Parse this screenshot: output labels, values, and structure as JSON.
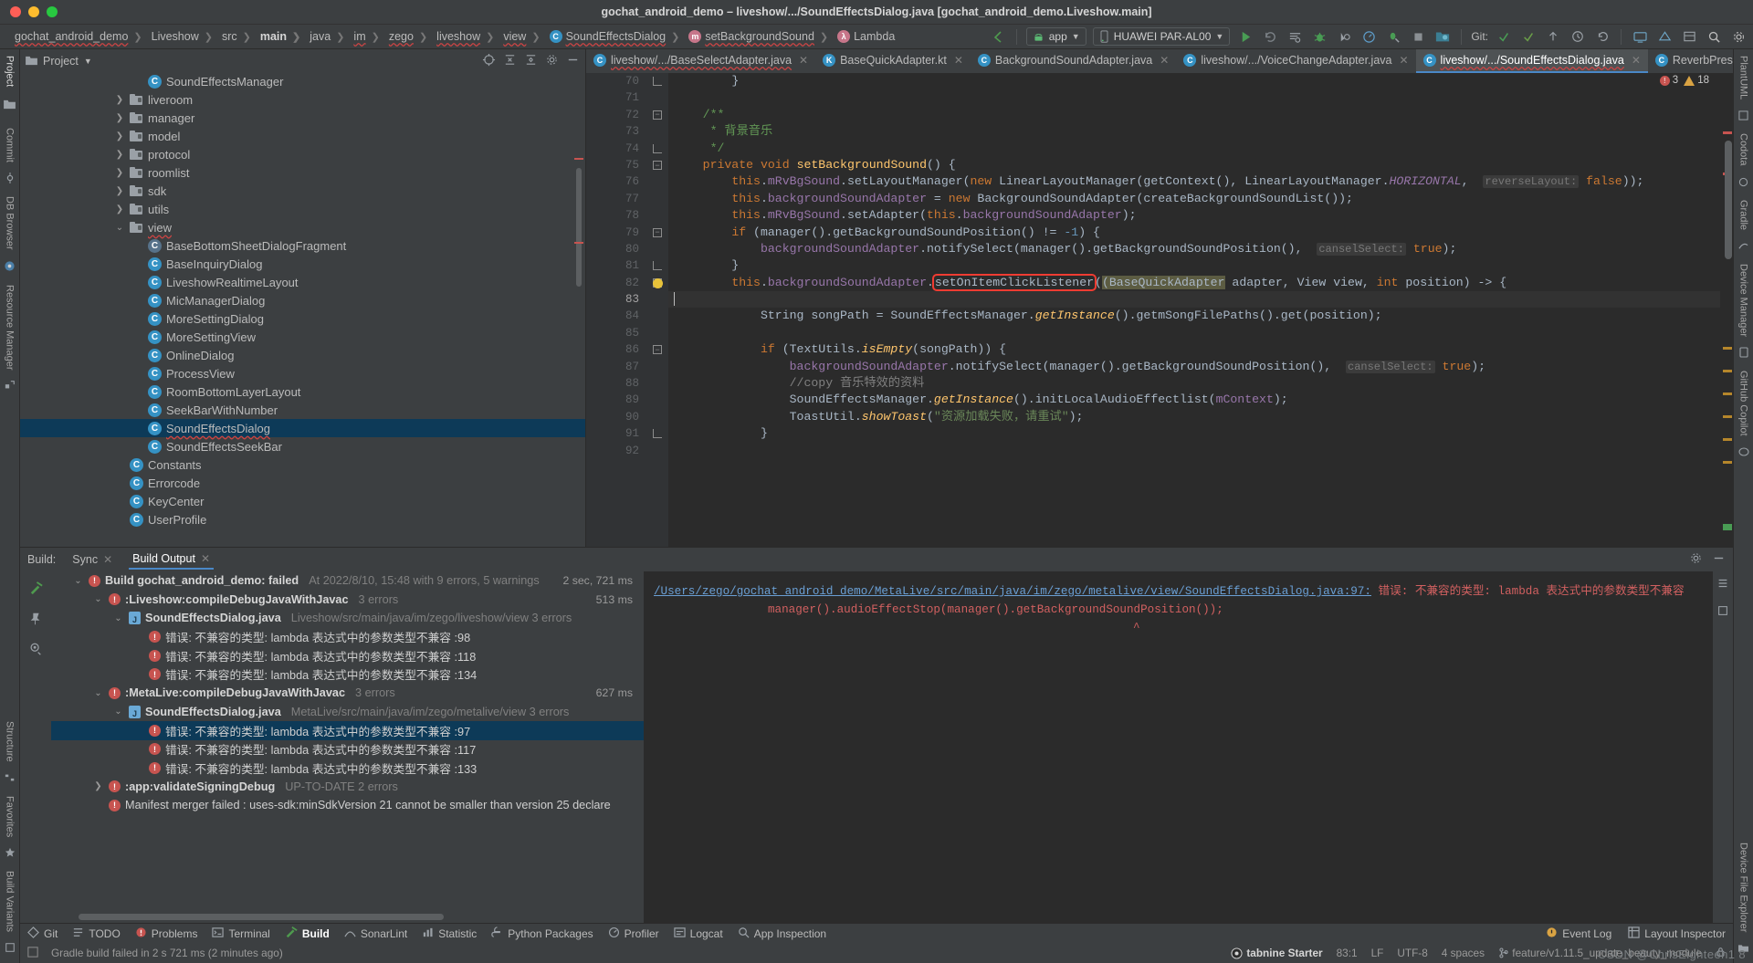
{
  "window": {
    "title": "gochat_android_demo – liveshow/.../SoundEffectsDialog.java [gochat_android_demo.Liveshow.main]"
  },
  "breadcrumb": [
    {
      "label": "gochat_android_demo",
      "bold": false,
      "icon": ""
    },
    {
      "label": "Liveshow",
      "bold": false,
      "icon": ""
    },
    {
      "label": "src",
      "bold": false,
      "icon": ""
    },
    {
      "label": "main",
      "bold": true,
      "icon": ""
    },
    {
      "label": "java",
      "bold": false,
      "icon": ""
    },
    {
      "label": "im",
      "bold": false,
      "icon": ""
    },
    {
      "label": "zego",
      "bold": false,
      "icon": ""
    },
    {
      "label": "liveshow",
      "bold": false,
      "icon": ""
    },
    {
      "label": "view",
      "bold": false,
      "icon": ""
    },
    {
      "label": "SoundEffectsDialog",
      "bold": false,
      "icon": "class-icon"
    },
    {
      "label": "setBackgroundSound",
      "bold": false,
      "icon": "method-icon"
    },
    {
      "label": "Lambda",
      "bold": false,
      "icon": "lambda-icon"
    }
  ],
  "toolbar": {
    "module_selector": "app",
    "device_selector": "HUAWEI PAR-AL00",
    "git_label": "Git:",
    "run_title": "run-button",
    "actions": [
      "run",
      "rerun",
      "edit-configurations",
      "debug",
      "debug-step",
      "profiler",
      "apply-changes",
      "stop",
      "device-file-explorer"
    ]
  },
  "project_panel": {
    "title": "Project",
    "tree": [
      {
        "depth": 5,
        "arrow": "",
        "icon": "class",
        "label": "SoundEffectsManager",
        "selected": false
      },
      {
        "depth": 4,
        "arrow": "right",
        "icon": "folder",
        "label": "liveroom",
        "selected": false
      },
      {
        "depth": 4,
        "arrow": "right",
        "icon": "folder",
        "label": "manager",
        "selected": false
      },
      {
        "depth": 4,
        "arrow": "right",
        "icon": "folder",
        "label": "model",
        "selected": false
      },
      {
        "depth": 4,
        "arrow": "right",
        "icon": "folder",
        "label": "protocol",
        "selected": false
      },
      {
        "depth": 4,
        "arrow": "right",
        "icon": "folder",
        "label": "roomlist",
        "selected": false
      },
      {
        "depth": 4,
        "arrow": "right",
        "icon": "folder",
        "label": "sdk",
        "selected": false
      },
      {
        "depth": 4,
        "arrow": "right",
        "icon": "folder",
        "label": "utils",
        "selected": false
      },
      {
        "depth": 4,
        "arrow": "down",
        "icon": "folder",
        "label": "view",
        "selected": false,
        "squiggle": true
      },
      {
        "depth": 5,
        "arrow": "",
        "icon": "class-abstract",
        "label": "BaseBottomSheetDialogFragment",
        "selected": false
      },
      {
        "depth": 5,
        "arrow": "",
        "icon": "class",
        "label": "BaseInquiryDialog",
        "selected": false
      },
      {
        "depth": 5,
        "arrow": "",
        "icon": "class",
        "label": "LiveshowRealtimeLayout",
        "selected": false
      },
      {
        "depth": 5,
        "arrow": "",
        "icon": "class",
        "label": "MicManagerDialog",
        "selected": false
      },
      {
        "depth": 5,
        "arrow": "",
        "icon": "class",
        "label": "MoreSettingDialog",
        "selected": false
      },
      {
        "depth": 5,
        "arrow": "",
        "icon": "class",
        "label": "MoreSettingView",
        "selected": false
      },
      {
        "depth": 5,
        "arrow": "",
        "icon": "class",
        "label": "OnlineDialog",
        "selected": false
      },
      {
        "depth": 5,
        "arrow": "",
        "icon": "class",
        "label": "ProcessView",
        "selected": false
      },
      {
        "depth": 5,
        "arrow": "",
        "icon": "class",
        "label": "RoomBottomLayerLayout",
        "selected": false
      },
      {
        "depth": 5,
        "arrow": "",
        "icon": "class",
        "label": "SeekBarWithNumber",
        "selected": false
      },
      {
        "depth": 5,
        "arrow": "",
        "icon": "class",
        "label": "SoundEffectsDialog",
        "selected": true,
        "squiggle": true
      },
      {
        "depth": 5,
        "arrow": "",
        "icon": "class",
        "label": "SoundEffectsSeekBar",
        "selected": false
      },
      {
        "depth": 4,
        "arrow": "",
        "icon": "class",
        "label": "Constants",
        "selected": false
      },
      {
        "depth": 4,
        "arrow": "",
        "icon": "class",
        "label": "Errorcode",
        "selected": false
      },
      {
        "depth": 4,
        "arrow": "",
        "icon": "class",
        "label": "KeyCenter",
        "selected": false
      },
      {
        "depth": 4,
        "arrow": "",
        "icon": "class",
        "label": "UserProfile",
        "selected": false
      }
    ]
  },
  "editor_tabs": [
    {
      "label": "liveshow/.../BaseSelectAdapter.java",
      "icon": "java-class",
      "active": false,
      "squiggle": true
    },
    {
      "label": "BaseQuickAdapter.kt",
      "icon": "kotlin-class",
      "active": false,
      "squiggle": false
    },
    {
      "label": "BackgroundSoundAdapter.java",
      "icon": "java-class",
      "active": false,
      "squiggle": false
    },
    {
      "label": "liveshow/.../VoiceChangeAdapter.java",
      "icon": "java-class",
      "active": false,
      "squiggle": false
    },
    {
      "label": "liveshow/.../SoundEffectsDialog.java",
      "icon": "java-class",
      "active": true,
      "squiggle": true
    },
    {
      "label": "ReverbPresetAdapter.ja",
      "icon": "java-class",
      "active": false,
      "squiggle": false
    }
  ],
  "inspection": {
    "errors": "3",
    "warnings": "18"
  },
  "code": {
    "first_line": 70,
    "lines": [
      {
        "n": 70,
        "html": "        <span class='typ'>}</span>",
        "fold": "end"
      },
      {
        "n": 71,
        "html": "",
        "fold": ""
      },
      {
        "n": 72,
        "html": "    <span class='grn'>/**</span>",
        "fold": "start"
      },
      {
        "n": 73,
        "html": "     <span class='grn'>* 背景音乐</span>",
        "fold": ""
      },
      {
        "n": 74,
        "html": "     <span class='grn'>*/</span>",
        "fold": "end"
      },
      {
        "n": 75,
        "html": "    <span class='kw'>private</span> <span class='kw'>void</span> <span class='mth'>setBackgroundSound</span>() {",
        "fold": "start"
      },
      {
        "n": 76,
        "html": "        <span class='kw'>this</span>.<span class='fld'>mRvBgSound</span>.setLayoutManager(<span class='kw'>new</span> LinearLayoutManager(getContext(), LinearLayoutManager.<span class='fld ital'>HORIZONTAL</span>,  <span class='hint'>reverseLayout:</span> <span class='kw'>false</span>));",
        "fold": ""
      },
      {
        "n": 77,
        "html": "        <span class='kw'>this</span>.<span class='fld'>backgroundSoundAdapter</span> = <span class='kw'>new</span> BackgroundSoundAdapter(createBackgroundSoundList());",
        "fold": ""
      },
      {
        "n": 78,
        "html": "        <span class='kw'>this</span>.<span class='fld'>mRvBgSound</span>.setAdapter(<span class='kw'>this</span>.<span class='fld'>backgroundSoundAdapter</span>);",
        "fold": ""
      },
      {
        "n": 79,
        "html": "        <span class='kw'>if</span> (manager().getBackgroundSoundPosition() != <span class='num'>-1</span>) {",
        "fold": "start"
      },
      {
        "n": 80,
        "html": "            <span class='fld'>backgroundSoundAdapter</span>.notifySelect(manager().getBackgroundSoundPosition(),  <span class='hint'>canselSelect:</span> <span class='kw'>true</span>);",
        "fold": ""
      },
      {
        "n": 81,
        "html": "        }",
        "fold": "end"
      },
      {
        "n": 82,
        "html": "        <span class='kw'>this</span>.<span class='fld'>backgroundSoundAdapter</span>.<span class='boxed'>setOnItemClickListener</span>(<span class='hl'>(BaseQuickAdapter</span> adapter, View view, <span class='kw'>int</span> position) -> {",
        "fold": "start",
        "bulb": true
      },
      {
        "n": 83,
        "html": "",
        "fold": "",
        "caret": true
      },
      {
        "n": 84,
        "html": "            String songPath = SoundEffectsManager.<span class='mth ital'>getInstance</span>().getmSongFilePaths().get(position);",
        "fold": ""
      },
      {
        "n": 85,
        "html": "",
        "fold": ""
      },
      {
        "n": 86,
        "html": "            <span class='kw'>if</span> (TextUtils.<span class='mth ital'>isEmpty</span>(songPath)) {",
        "fold": "start"
      },
      {
        "n": 87,
        "html": "                <span class='fld'>backgroundSoundAdapter</span>.notifySelect(manager().getBackgroundSoundPosition(),  <span class='hint'>canselSelect:</span> <span class='kw'>true</span>);",
        "fold": ""
      },
      {
        "n": 88,
        "html": "                <span class='cmt'>//copy 音乐特效的资料</span>",
        "fold": ""
      },
      {
        "n": 89,
        "html": "                SoundEffectsManager.<span class='mth ital'>getInstance</span>().initLocalAudioEffectlist(<span class='fld'>mContext</span>);",
        "fold": ""
      },
      {
        "n": 90,
        "html": "                ToastUtil.<span class='mth ital'>showToast</span>(<span class='str'>\"资源加载失败，请重试\"</span>);",
        "fold": ""
      },
      {
        "n": 91,
        "html": "            }",
        "fold": "end"
      },
      {
        "n": 92,
        "html": "",
        "fold": ""
      }
    ]
  },
  "build_panel": {
    "label": "Build:",
    "tabs": [
      {
        "label": "Sync",
        "active": false
      },
      {
        "label": "Build Output",
        "active": true
      }
    ],
    "rows": [
      {
        "indent": 0,
        "arrow": "down",
        "icon": "error",
        "bold": "Build gochat_android_demo: failed",
        "muted": "At 2022/8/10, 15:48 with 9 errors, 5 warnings",
        "time": "2 sec, 721 ms",
        "selected": false
      },
      {
        "indent": 1,
        "arrow": "down",
        "icon": "error",
        "bold": ":Liveshow:compileDebugJavaWithJavac",
        "muted": "3 errors",
        "time": "513 ms",
        "selected": false
      },
      {
        "indent": 2,
        "arrow": "down",
        "icon": "java",
        "bold": "SoundEffectsDialog.java",
        "muted": "Liveshow/src/main/java/im/zego/liveshow/view 3 errors",
        "time": "",
        "selected": false
      },
      {
        "indent": 3,
        "arrow": "",
        "icon": "error",
        "bold": "",
        "muted": "",
        "text": "错误: 不兼容的类型: lambda 表达式中的参数类型不兼容 :98",
        "time": "",
        "selected": false
      },
      {
        "indent": 3,
        "arrow": "",
        "icon": "error",
        "bold": "",
        "muted": "",
        "text": "错误: 不兼容的类型: lambda 表达式中的参数类型不兼容 :118",
        "time": "",
        "selected": false
      },
      {
        "indent": 3,
        "arrow": "",
        "icon": "error",
        "bold": "",
        "muted": "",
        "text": "错误: 不兼容的类型: lambda 表达式中的参数类型不兼容 :134",
        "time": "",
        "selected": false
      },
      {
        "indent": 1,
        "arrow": "down",
        "icon": "error",
        "bold": ":MetaLive:compileDebugJavaWithJavac",
        "muted": "3 errors",
        "time": "627 ms",
        "selected": false
      },
      {
        "indent": 2,
        "arrow": "down",
        "icon": "java",
        "bold": "SoundEffectsDialog.java",
        "muted": "MetaLive/src/main/java/im/zego/metalive/view 3 errors",
        "time": "",
        "selected": false
      },
      {
        "indent": 3,
        "arrow": "",
        "icon": "error",
        "bold": "",
        "muted": "",
        "text": "错误: 不兼容的类型: lambda 表达式中的参数类型不兼容 :97",
        "time": "",
        "selected": true
      },
      {
        "indent": 3,
        "arrow": "",
        "icon": "error",
        "bold": "",
        "muted": "",
        "text": "错误: 不兼容的类型: lambda 表达式中的参数类型不兼容 :117",
        "time": "",
        "selected": false
      },
      {
        "indent": 3,
        "arrow": "",
        "icon": "error",
        "bold": "",
        "muted": "",
        "text": "错误: 不兼容的类型: lambda 表达式中的参数类型不兼容 :133",
        "time": "",
        "selected": false
      },
      {
        "indent": 1,
        "arrow": "right",
        "icon": "error",
        "bold": ":app:validateSigningDebug",
        "muted": "UP-TO-DATE 2 errors",
        "time": "",
        "selected": false
      },
      {
        "indent": 1,
        "arrow": "",
        "icon": "error",
        "bold": "",
        "muted": "",
        "text": "Manifest merger failed : uses-sdk:minSdkVersion 21 cannot be smaller than version 25 declare",
        "time": "",
        "selected": false
      }
    ],
    "detail": {
      "link": "/Users/zego/gochat_android_demo/MetaLive/src/main/java/im/zego/metalive/view/SoundEffectsDialog.java:97:",
      "error_text": "错误: 不兼容的类型: lambda 表达式中的参数类型不兼容",
      "code_line": "manager().audioEffectStop(manager().getBackgroundSoundPosition());",
      "caret_marker": "^"
    }
  },
  "status_bar": {
    "items": [
      {
        "label": "Git",
        "icon": "git-icon",
        "active": false
      },
      {
        "label": "TODO",
        "icon": "todo-icon",
        "active": false
      },
      {
        "label": "Problems",
        "icon": "problems-icon",
        "active": false
      },
      {
        "label": "Terminal",
        "icon": "terminal-icon",
        "active": false
      },
      {
        "label": "Build",
        "icon": "build-icon",
        "active": true
      },
      {
        "label": "SonarLint",
        "icon": "sonarlint-icon",
        "active": false
      },
      {
        "label": "Statistic",
        "icon": "statistic-icon",
        "active": false
      },
      {
        "label": "Python Packages",
        "icon": "python-icon",
        "active": false
      },
      {
        "label": "Profiler",
        "icon": "profiler-icon",
        "active": false
      },
      {
        "label": "Logcat",
        "icon": "logcat-icon",
        "active": false
      },
      {
        "label": "App Inspection",
        "icon": "inspection-icon",
        "active": false
      }
    ],
    "right_items": [
      {
        "label": "Event Log",
        "icon": "event-log-icon"
      },
      {
        "label": "Layout Inspector",
        "icon": "layout-inspector-icon"
      }
    ],
    "message": "Gradle build failed in 2 s 721 ms (2 minutes ago)",
    "tabnine": "tabnine Starter",
    "caret_position": "83:1",
    "line_sep": "LF",
    "encoding": "UTF-8",
    "indent": "4 spaces",
    "branch": "feature/v1.11.5_update_beauty_module",
    "watermark": "CSDN @ChrisEighteen1 8"
  },
  "left_rail": [
    "Project",
    "Commit",
    "DB Browser",
    "Resource Manager",
    "Structure",
    "Favorites",
    "Build Variants"
  ],
  "right_rail": [
    "PlantUML",
    "Codota",
    "Gradle",
    "Device Manager",
    "GitHub Copilot",
    "Device File Explorer"
  ],
  "colors": {
    "accent": "#4a88c7",
    "error": "#c75450",
    "warning": "#d9a343",
    "selection": "#0d3a58",
    "panel_bg": "#3c3f41",
    "editor_bg": "#2b2b2b"
  }
}
